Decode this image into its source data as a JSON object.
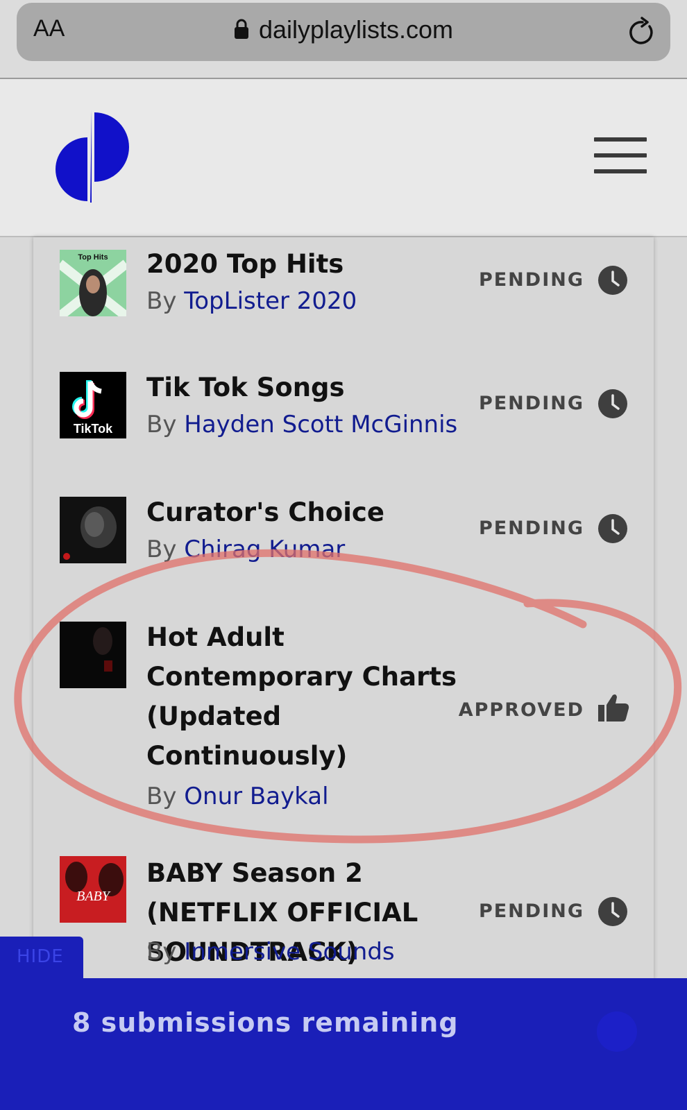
{
  "browser": {
    "text_size_label": "AA",
    "url": "dailyplaylists.com"
  },
  "header": {
    "logo_icon": "dailyplaylists-logo",
    "menu_icon": "hamburger-menu-icon",
    "brand_color": "#1111c9"
  },
  "submissions": [
    {
      "title": "2020 Top Hits",
      "by": "By",
      "curator": "TopLister 2020",
      "status": "PENDING",
      "status_icon": "clock-icon",
      "thumb_text": "Top Hits"
    },
    {
      "title": "Tik Tok Songs",
      "by": "By",
      "curator": "Hayden Scott McGinnis",
      "status": "PENDING",
      "status_icon": "clock-icon",
      "thumb_text": "TikTok"
    },
    {
      "title": "Curator's Choice",
      "by": "By",
      "curator": "Chirag Kumar",
      "status": "PENDING",
      "status_icon": "clock-icon"
    },
    {
      "title": "Hot Adult Contemporary Charts (Updated Continuously)",
      "by": "By",
      "curator": "Onur Baykal",
      "status": "APPROVED",
      "status_icon": "thumbs-up-icon"
    },
    {
      "title": "BABY Season 2 (NETFLIX OFFICIAL SOUNDTRACK)",
      "by": "By",
      "curator": "Inmersive Sounds",
      "status": "PENDING",
      "status_icon": "clock-icon",
      "thumb_text": "BABY"
    }
  ],
  "footer": {
    "hide_label": "HIDE",
    "remaining_text": "8 submissions remaining"
  },
  "colors": {
    "accent_blue": "#1a1fb8",
    "curator_link": "#111c8f",
    "annotation_red": "#e0706a"
  }
}
